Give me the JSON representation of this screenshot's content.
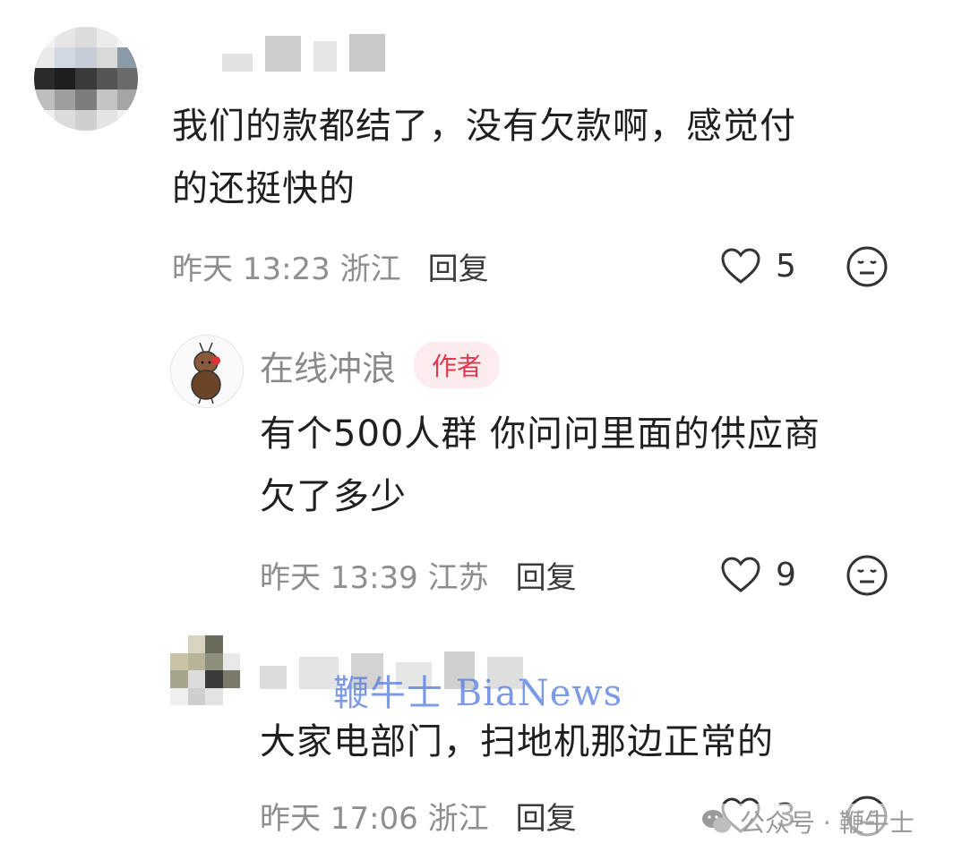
{
  "comments": [
    {
      "text": "我们的款都结了，没有欠款啊，感觉付的还挺快的",
      "text_line1": "我们的款都结了，没有欠款啊，感觉付",
      "text_line2": "的还挺快的",
      "time": "昨天 13:23 浙江",
      "reply_label": "回复",
      "likes": "5"
    }
  ],
  "reply1": {
    "username": "在线冲浪",
    "author_tag": "作者",
    "text_line1": "有个500人群 你问问里面的供应商",
    "text_line2": "欠了多少",
    "time": "昨天 13:39 江苏",
    "reply_label": "回复",
    "likes": "9"
  },
  "reply2": {
    "text": "大家电部门，扫地机那边正常的",
    "time": "昨天 17:06 浙江",
    "reply_label": "回复",
    "likes": "3"
  },
  "watermark": {
    "overlay": "鞭牛士 BiaNews",
    "footer": "公众号 · 鞭牛士"
  },
  "icons": [
    "heart-icon",
    "neutral-face-icon",
    "wechat-icon"
  ]
}
